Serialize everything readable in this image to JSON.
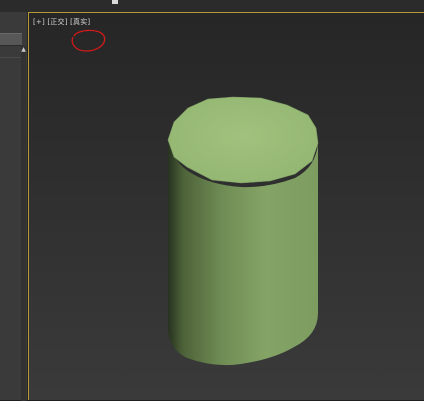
{
  "viewport": {
    "labels": {
      "plus": "[+]",
      "view": "[正交]",
      "shading": "[真实]"
    },
    "annotation_color": "#d21a1a",
    "frame_color": "#b59a39"
  },
  "object": {
    "shape": "cylinder",
    "top_color": "#9bbf78",
    "side_light": "#85a566",
    "side_dark": "#2d3a22"
  },
  "icons": {
    "scroll_up": "▲"
  }
}
